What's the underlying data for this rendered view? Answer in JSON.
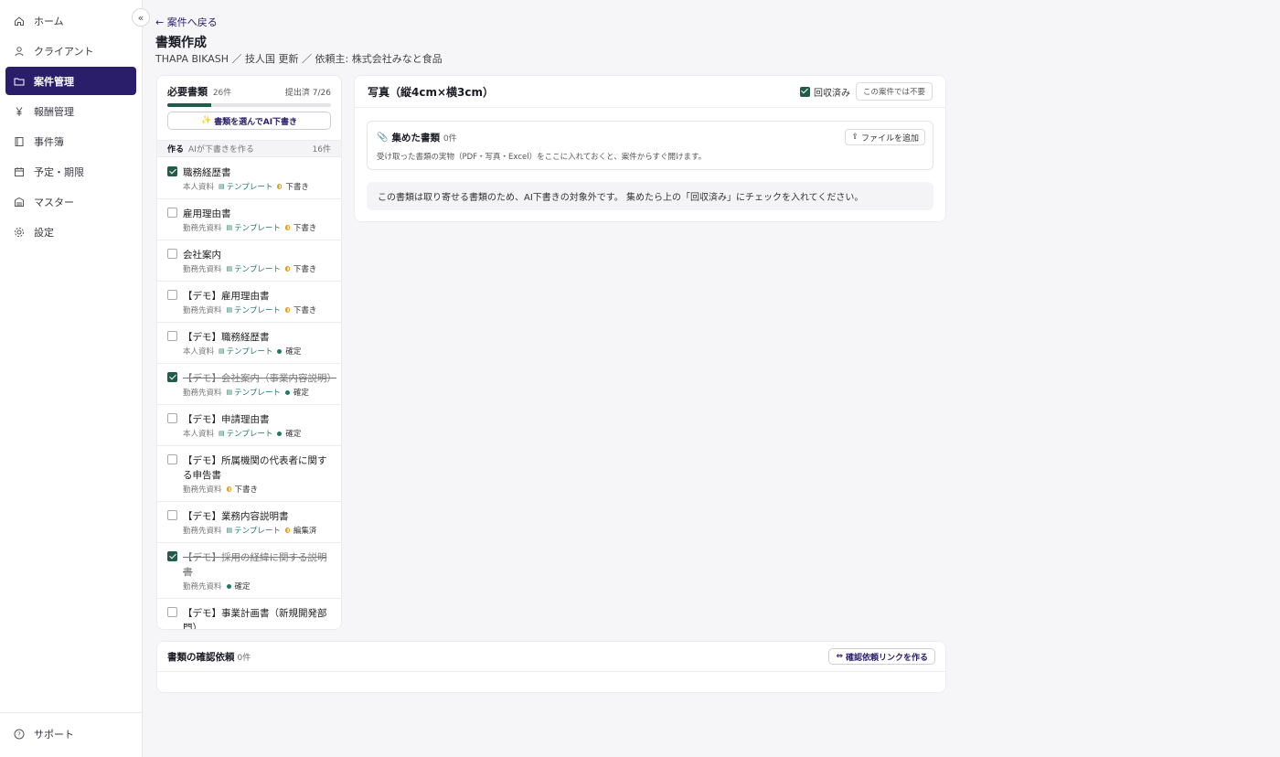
{
  "nav": {
    "collapse_icon": "«",
    "items": [
      {
        "label": "ホーム",
        "icon": "home-icon"
      },
      {
        "label": "クライアント",
        "icon": "user-icon"
      },
      {
        "label": "案件管理",
        "icon": "folder-icon"
      },
      {
        "label": "報酬管理",
        "icon": "yen-icon"
      },
      {
        "label": "事件簿",
        "icon": "book-icon"
      },
      {
        "label": "予定・期限",
        "icon": "calendar-icon"
      },
      {
        "label": "マスター",
        "icon": "building-icon"
      },
      {
        "label": "設定",
        "icon": "gear-icon"
      }
    ],
    "active_index": 2,
    "support_label": "サポート"
  },
  "header": {
    "back_label": "← 案件へ戻る",
    "title": "書類作成",
    "subtitle": "THAPA BIKASH ／ 技人国 更新 ／ 依頼主: 株式会社みなと食品"
  },
  "left_panel": {
    "title": "必要書類",
    "count": "26件",
    "submitted": "提出済 7/26",
    "progress": 0.27,
    "ai_button": "書類を選んでAI下書き",
    "section_label": "作る",
    "section_hint": "AIが下書きを作る",
    "section_count": "16件",
    "items": [
      {
        "name": "職務経歴書",
        "source": "本人資料",
        "template": "テンプレート",
        "status": "下書き",
        "checked": true,
        "struck": false,
        "dot": "half"
      },
      {
        "name": "雇用理由書",
        "source": "勤務先資料",
        "template": "テンプレート",
        "status": "下書き",
        "checked": false,
        "struck": false,
        "dot": "half"
      },
      {
        "name": "会社案内",
        "source": "勤務先資料",
        "template": "テンプレート",
        "status": "下書き",
        "checked": false,
        "struck": false,
        "dot": "half"
      },
      {
        "name": "【デモ】雇用理由書",
        "source": "勤務先資料",
        "template": "テンプレート",
        "status": "下書き",
        "checked": false,
        "struck": false,
        "dot": "half"
      },
      {
        "name": "【デモ】職務経歴書",
        "source": "本人資料",
        "template": "テンプレート",
        "status": "確定",
        "checked": false,
        "struck": false,
        "dot": "full"
      },
      {
        "name": "【デモ】会社案内（事業内容説明）",
        "source": "勤務先資料",
        "template": "テンプレート",
        "status": "確定",
        "checked": true,
        "struck": true,
        "dot": "full"
      },
      {
        "name": "【デモ】申請理由書",
        "source": "本人資料",
        "template": "テンプレート",
        "status": "確定",
        "checked": false,
        "struck": false,
        "dot": "full"
      },
      {
        "name": "【デモ】所属機関の代表者に関する申告書",
        "source": "勤務先資料",
        "template": "",
        "status": "下書き",
        "checked": false,
        "struck": false,
        "dot": "half"
      },
      {
        "name": "【デモ】業務内容説明書",
        "source": "勤務先資料",
        "template": "テンプレート",
        "status": "編集済",
        "checked": false,
        "struck": false,
        "dot": "half"
      },
      {
        "name": "【デモ】採用の経緯に関する説明書",
        "source": "勤務先資料",
        "template": "",
        "status": "確定",
        "checked": true,
        "struck": true,
        "dot": "full"
      },
      {
        "name": "【デモ】事業計画書（新規開発部門）",
        "source": "",
        "template": "",
        "status": "",
        "checked": false,
        "struck": false,
        "dot": ""
      }
    ]
  },
  "main_panel": {
    "title": "写真（縦4cm×横3cm）",
    "collected_label": "回収済み",
    "not_needed_label": "この案件では不要",
    "gathered_title": "集めた書類",
    "gathered_count": "0件",
    "add_file_label": "ファイルを追加",
    "gathered_desc": "受け取った書類の実物（PDF・写真・Excel）をここに入れておくと、案件からすぐ開けます。",
    "info": "この書類は取り寄せる書類のため、AI下書きの対象外です。 集めたら上の「回収済み」にチェックを入れてください。"
  },
  "bottom_panel": {
    "title": "書類の確認依頼",
    "count": "0件",
    "button": "確認依頼リンクを作る"
  },
  "colors": {
    "accent": "#2a1e6b",
    "success": "#1f5c4a",
    "draft": "#e0a020"
  }
}
